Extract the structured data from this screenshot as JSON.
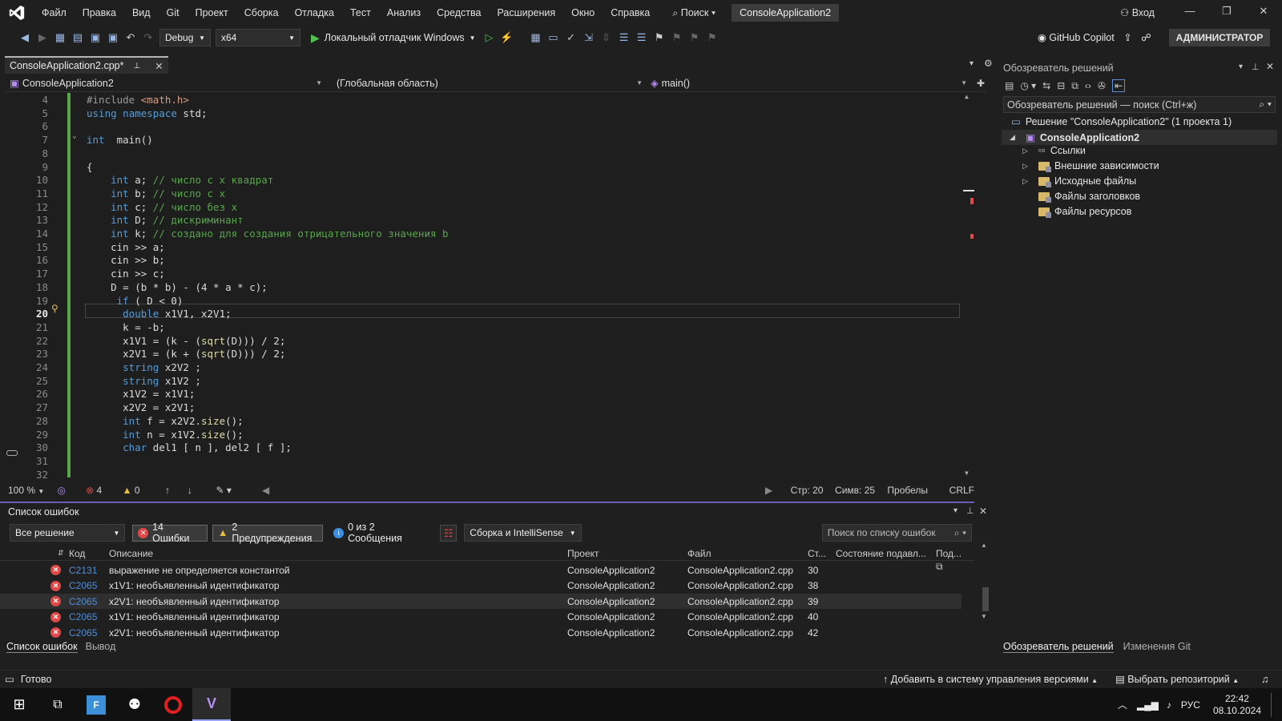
{
  "menu": [
    "Файл",
    "Правка",
    "Вид",
    "Git",
    "Проект",
    "Сборка",
    "Отладка",
    "Тест",
    "Анализ",
    "Средства",
    "Расширения",
    "Окно",
    "Справка"
  ],
  "search_label": "Поиск",
  "solution_title": "ConsoleApplication2",
  "login": "Вход",
  "toolbar": {
    "config": "Debug",
    "platform": "x64",
    "debugger": "Локальный отладчик Windows",
    "copilot": "GitHub Copilot",
    "admin": "АДМИНИСТРАТОР"
  },
  "doc_tab": "ConsoleApplication2.cpp*",
  "nav": {
    "project": "ConsoleApplication2",
    "scope": "(Глобальная область)",
    "member": "main()"
  },
  "code_lines": [
    {
      "n": "4",
      "t": "#include <math.h>"
    },
    {
      "n": "5",
      "t": "using namespace std;"
    },
    {
      "n": "6",
      "t": ""
    },
    {
      "n": "7",
      "t": "int  main()"
    },
    {
      "n": "8",
      "t": ""
    },
    {
      "n": "9",
      "t": "{"
    },
    {
      "n": "10",
      "t": "    int a; // число с х квадрат"
    },
    {
      "n": "11",
      "t": "    int b; // число с х"
    },
    {
      "n": "12",
      "t": "    int c; // число без х"
    },
    {
      "n": "13",
      "t": "    int D; // дискриминант"
    },
    {
      "n": "14",
      "t": "    int k; // создано для создания отрицательного значения b"
    },
    {
      "n": "15",
      "t": "    cin >> a;"
    },
    {
      "n": "16",
      "t": "    cin >> b;"
    },
    {
      "n": "17",
      "t": "    cin >> c;"
    },
    {
      "n": "18",
      "t": "    D = (b * b) - (4 * a * c);"
    },
    {
      "n": "19",
      "t": "     if ( D < 0)"
    },
    {
      "n": "20",
      "t": "      double x1V1, x2V1;"
    },
    {
      "n": "21",
      "t": "      k = -b;"
    },
    {
      "n": "22",
      "t": "      x1V1 = (k - (sqrt(D))) / 2;"
    },
    {
      "n": "23",
      "t": "      x2V1 = (k + (sqrt(D))) / 2;"
    },
    {
      "n": "24",
      "t": "      string x2V2 ;"
    },
    {
      "n": "25",
      "t": "      string x1V2 ;"
    },
    {
      "n": "26",
      "t": "      x1V2 = x1V1;"
    },
    {
      "n": "27",
      "t": "      x2V2 = x2V1;"
    },
    {
      "n": "28",
      "t": "      int f = x2V2.size();"
    },
    {
      "n": "29",
      "t": "      int n = x1V2.size();"
    },
    {
      "n": "30",
      "t": "      char del1 [ n ], del2 [ f ];"
    },
    {
      "n": "31",
      "t": ""
    },
    {
      "n": "32",
      "t": ""
    }
  ],
  "editor_status": {
    "zoom": "100 %",
    "errors": "4",
    "warnings": "0",
    "line": "Стр: 20",
    "col": "Симв: 25",
    "spaces": "Пробелы",
    "eol": "CRLF"
  },
  "errlist": {
    "title": "Список ошибок",
    "scope": "Все решение",
    "errors_chip": "14 Ошибки",
    "warnings_chip": "2 Предупреждения",
    "messages_chip": "0 из 2 Сообщения",
    "build_filter": "Сборка и IntelliSense",
    "search_placeholder": "Поиск по списку ошибок",
    "headers": {
      "code": "Код",
      "desc": "Описание",
      "project": "Проект",
      "file": "Файл",
      "line": "Ст...",
      "suppress": "Состояние подавл...",
      "sub": "Под..."
    },
    "rows": [
      {
        "code": "C2131",
        "desc": "выражение не определяется константой",
        "project": "ConsoleApplication2",
        "file": "ConsoleApplication2.cpp",
        "line": "30"
      },
      {
        "code": "C2065",
        "desc": "x1V1: необъявленный идентификатор",
        "project": "ConsoleApplication2",
        "file": "ConsoleApplication2.cpp",
        "line": "38"
      },
      {
        "code": "C2065",
        "desc": "x2V1: необъявленный идентификатор",
        "project": "ConsoleApplication2",
        "file": "ConsoleApplication2.cpp",
        "line": "39"
      },
      {
        "code": "C2065",
        "desc": "x1V1: необъявленный идентификатор",
        "project": "ConsoleApplication2",
        "file": "ConsoleApplication2.cpp",
        "line": "40"
      },
      {
        "code": "C2065",
        "desc": "x2V1: необъявленный идентификатор",
        "project": "ConsoleApplication2",
        "file": "ConsoleApplication2.cpp",
        "line": "42"
      }
    ],
    "tabs": [
      "Список ошибок",
      "Вывод"
    ]
  },
  "solution": {
    "title": "Обозреватель решений",
    "search": "Обозреватель решений — поиск (Ctrl+ж)",
    "root": "Решение \"ConsoleApplication2\"  (1 проекта 1)",
    "project": "ConsoleApplication2",
    "items": [
      "Ссылки",
      "Внешние зависимости",
      "Исходные файлы",
      "Файлы заголовков",
      "Файлы ресурсов"
    ],
    "tabs": [
      "Обозреватель решений",
      "Изменения Git"
    ]
  },
  "status": {
    "ready": "Готово",
    "vcs": "Добавить в систему управления версиями",
    "repo": "Выбрать репозиторий"
  },
  "taskbar": {
    "lang": "РУС",
    "time": "22:42",
    "date": "08.10.2024"
  }
}
